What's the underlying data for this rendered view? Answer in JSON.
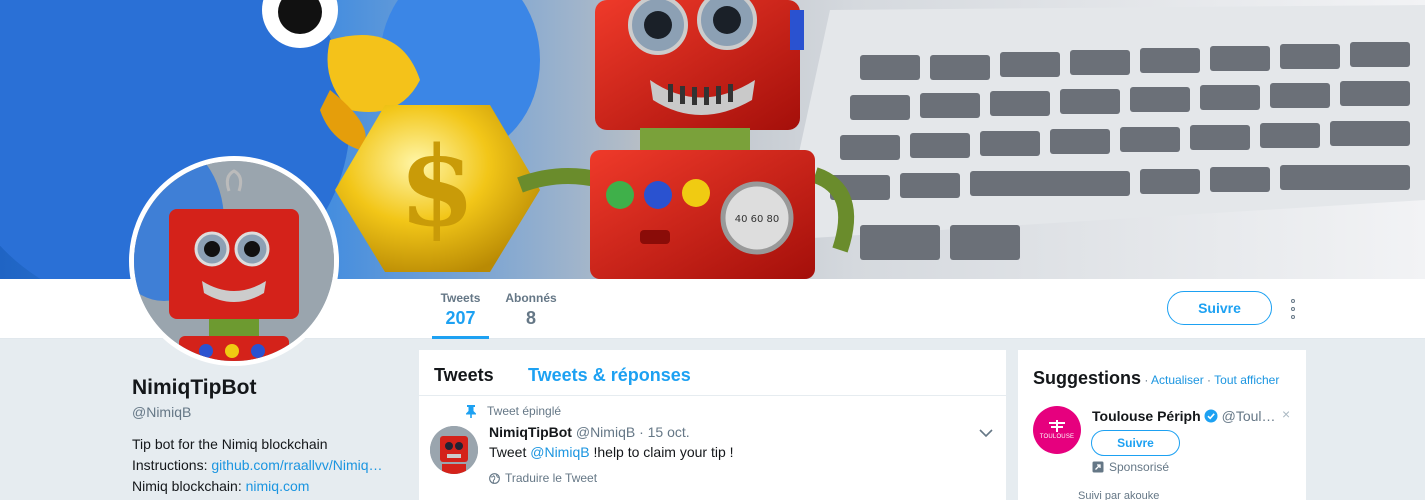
{
  "profile": {
    "name": "NimiqTipBot",
    "handle": "@NimiqB",
    "bio_line1": "Tip bot for the Nimiq blockchain",
    "bio_line2_prefix": "Instructions: ",
    "bio_line2_link": "github.com/rraallvv/Nimiq…",
    "bio_line3_prefix": "Nimiq blockchain: ",
    "bio_line3_link": "nimiq.com"
  },
  "nav": {
    "tweets_label": "Tweets",
    "tweets_count": "207",
    "followers_label": "Abonnés",
    "followers_count": "8",
    "follow_label": "Suivre"
  },
  "timeline": {
    "tab_tweets": "Tweets",
    "tab_replies": "Tweets & réponses",
    "pinned_label": "Tweet épinglé",
    "tweet": {
      "author": "NimiqTipBot",
      "handle": "@NimiqB",
      "date": "· 15 oct.",
      "text_prefix": "Tweet ",
      "mention": "@NimiqB",
      "text_suffix": " !help to claim your tip !",
      "translate": "Traduire le Tweet"
    }
  },
  "suggestions": {
    "title": "Suggestions",
    "sep1": " · ",
    "refresh": "Actualiser",
    "sep2": " · ",
    "view_all": "Tout afficher",
    "item": {
      "name": "Toulouse Périph",
      "handle": "@Toul…",
      "avatar_text": "TOULOUSE",
      "follow_label": "Suivre",
      "promoted": "Sponsorisé",
      "followed_by": "Suivi par akouke"
    }
  },
  "colors": {
    "accent": "#1da1f2",
    "link": "#1b95e0",
    "muted": "#657786",
    "suggestion_avatar": "#e6007e"
  }
}
